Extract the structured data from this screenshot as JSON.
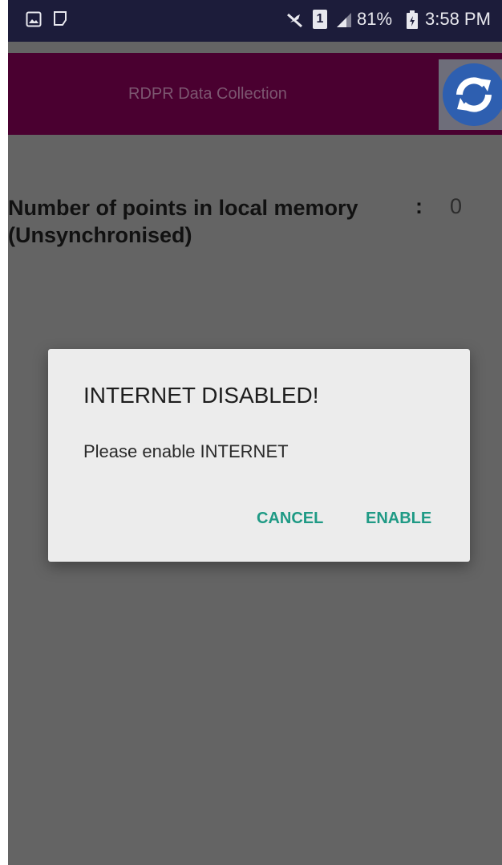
{
  "status_bar": {
    "battery": "81%",
    "time": "3:58 PM",
    "sim_label": "1",
    "icons": [
      "gallery-icon",
      "notification-icon",
      "mute-icon",
      "sim-icon",
      "signal-icon",
      "battery-icon"
    ]
  },
  "app": {
    "title": "RDPR Data Collection",
    "sync_icon": "sync-icon",
    "colors": {
      "app_bar": "#4a0030",
      "sync_circle": "#2e5fb0"
    }
  },
  "main": {
    "counter_label_line1": "Number of points in local memory",
    "counter_label_line2": "(Unsynchronised)",
    "counter_colon": ":",
    "counter_value": "0"
  },
  "dialog": {
    "title": "INTERNET DISABLED!",
    "message": "Please enable INTERNET",
    "cancel_label": "CANCEL",
    "enable_label": "ENABLE",
    "accent": "#1f9a85"
  }
}
